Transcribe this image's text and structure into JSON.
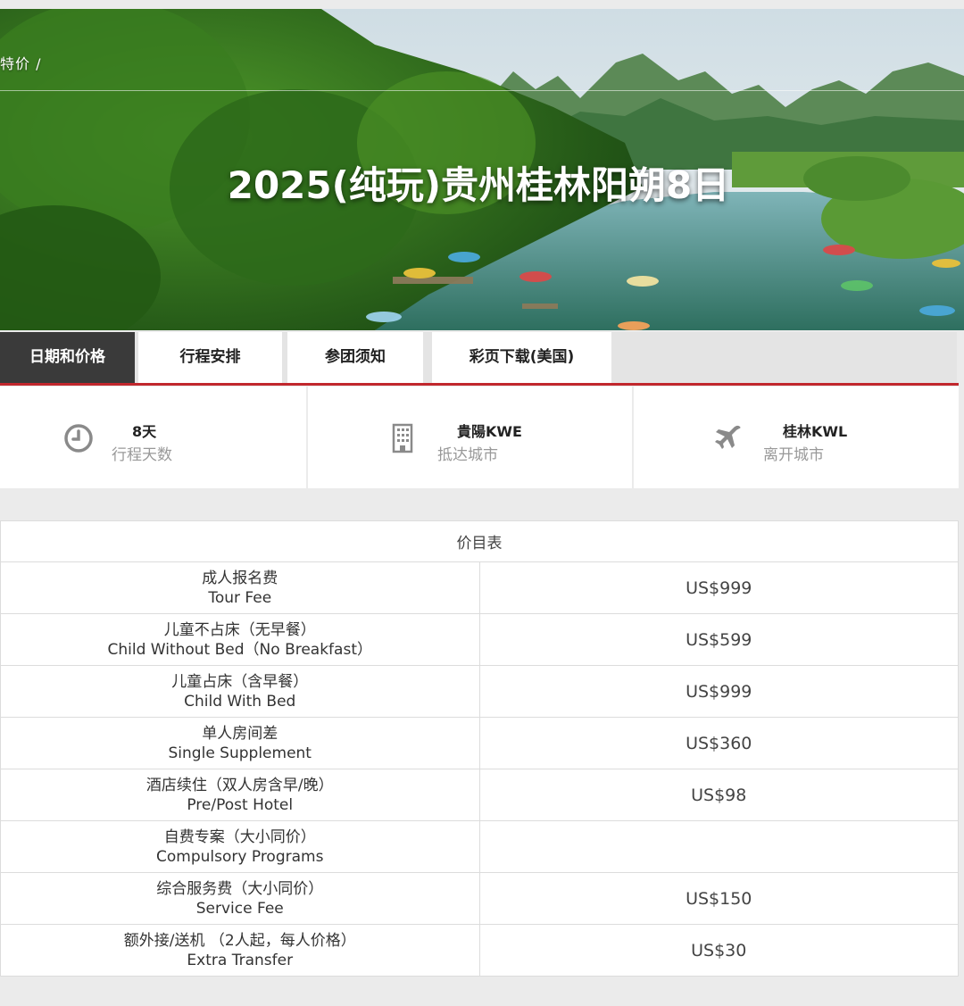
{
  "hero": {
    "breadcrumb": "特价  /",
    "title": "2025(纯玩)贵州桂林阳朔8日"
  },
  "tabs": [
    {
      "label": "日期和价格",
      "active": true
    },
    {
      "label": "行程安排",
      "active": false
    },
    {
      "label": "参团须知",
      "active": false
    },
    {
      "label": "彩页下载(美国)",
      "active": false
    }
  ],
  "info": [
    {
      "icon": "clock-icon",
      "value": "8天",
      "label": "行程天数"
    },
    {
      "icon": "building-icon",
      "value": "貴陽KWE",
      "label": "抵达城市"
    },
    {
      "icon": "airplane-icon",
      "value": "桂林KWL",
      "label": "离开城市"
    }
  ],
  "price_table": {
    "header": "价目表",
    "rows": [
      {
        "cn": "成人报名费",
        "en": "Tour Fee",
        "price": "US$999"
      },
      {
        "cn": "儿童不占床（无早餐）",
        "en": "Child Without Bed（No Breakfast）",
        "price": "US$599"
      },
      {
        "cn": "儿童占床（含早餐）",
        "en": "Child With Bed",
        "price": "US$999"
      },
      {
        "cn": "单人房间差",
        "en": "Single Supplement",
        "price": "US$360"
      },
      {
        "cn": "酒店续住（双人房含早/晚）",
        "en": "Pre/Post Hotel",
        "price": "US$98"
      },
      {
        "cn": "自费专案（大小同价）",
        "en": "Compulsory Programs",
        "price": ""
      },
      {
        "cn": "综合服务费（大小同价）",
        "en": "Service Fee",
        "price": "US$150"
      },
      {
        "cn": "额外接/送机 （2人起，每人价格）",
        "en": "Extra Transfer",
        "price": "US$30"
      }
    ]
  },
  "colors": {
    "accent": "#c1272d",
    "active_tab": "#3a3a3a"
  }
}
